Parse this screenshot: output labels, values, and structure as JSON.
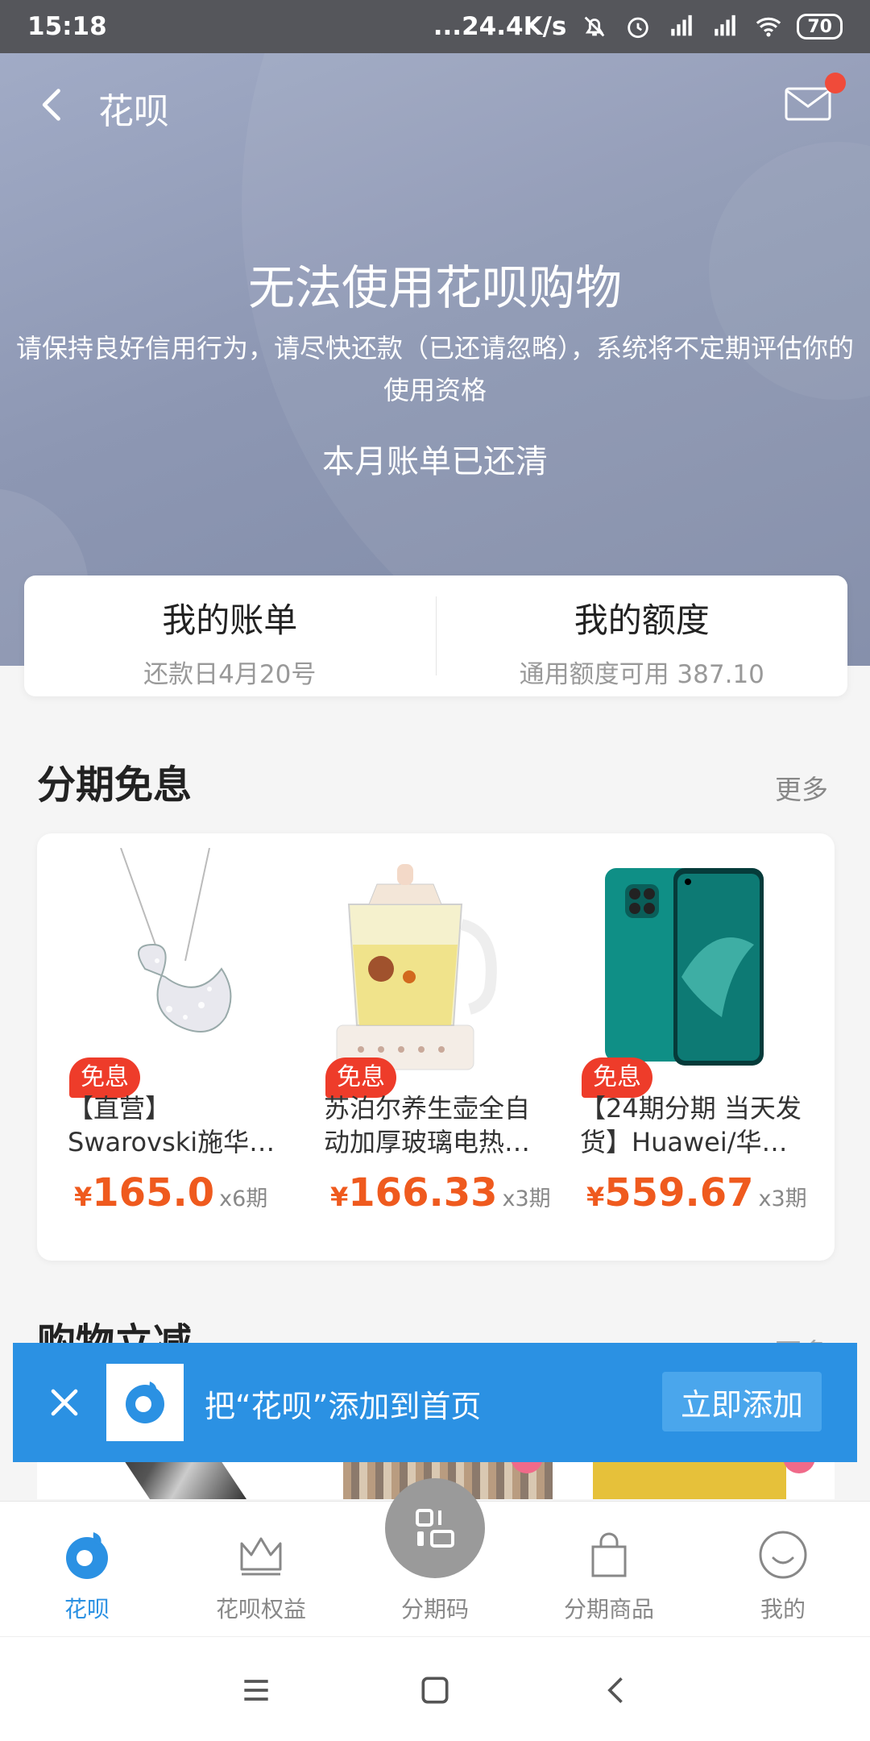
{
  "status_bar": {
    "time": "15:18",
    "net_speed": "...24.4K/s",
    "icons": [
      "mute-bell-icon",
      "alarm-icon",
      "signal-hd-icon",
      "signal-hd-icon",
      "wifi-icon"
    ],
    "battery": "70"
  },
  "nav": {
    "title": "花呗",
    "has_unread_mail": true
  },
  "hero": {
    "title": "无法使用花呗购物",
    "description": "请保持良好信用行为，请尽快还款（已还请忽略），系统将不定期评估你的使用资格",
    "status": "本月账单已还清"
  },
  "summary": {
    "bill": {
      "title": "我的账单",
      "subtitle": "还款日4月20号"
    },
    "credit": {
      "title": "我的额度",
      "subtitle": "通用额度可用 387.10"
    }
  },
  "installments": {
    "title": "分期免息",
    "more": "更多",
    "products": [
      {
        "badge": "免息",
        "name": "【直营】Swarovski施华洛世奇天鹅…",
        "currency": "¥",
        "price": "165.0",
        "period": "x6期",
        "image": "swan-necklace"
      },
      {
        "badge": "免息",
        "name": "苏泊尔养生壶全自动加厚玻璃电热…",
        "currency": "¥",
        "price": "166.33",
        "period": "x3期",
        "image": "health-kettle"
      },
      {
        "badge": "免息",
        "name": "【24期分期 当天发货】Huawei/华…",
        "currency": "¥",
        "price": "559.67",
        "period": "x3期",
        "image": "green-phone"
      }
    ]
  },
  "section2": {
    "title": "购物立减",
    "more": "更多"
  },
  "banner": {
    "text": "把“花呗”添加到首页",
    "button": "立即添加"
  },
  "tabs": [
    {
      "label": "花呗",
      "icon": "huabei-icon",
      "active": true
    },
    {
      "label": "花呗权益",
      "icon": "crown-icon",
      "active": false
    },
    {
      "label": "分期码",
      "icon": "qr-code-icon",
      "active": false
    },
    {
      "label": "分期商品",
      "icon": "shopping-bag-icon",
      "active": false
    },
    {
      "label": "我的",
      "icon": "smile-icon",
      "active": false
    }
  ],
  "colors": {
    "accent": "#2b91e3",
    "price": "#ef5a1e",
    "badge": "#ee3c2a"
  }
}
